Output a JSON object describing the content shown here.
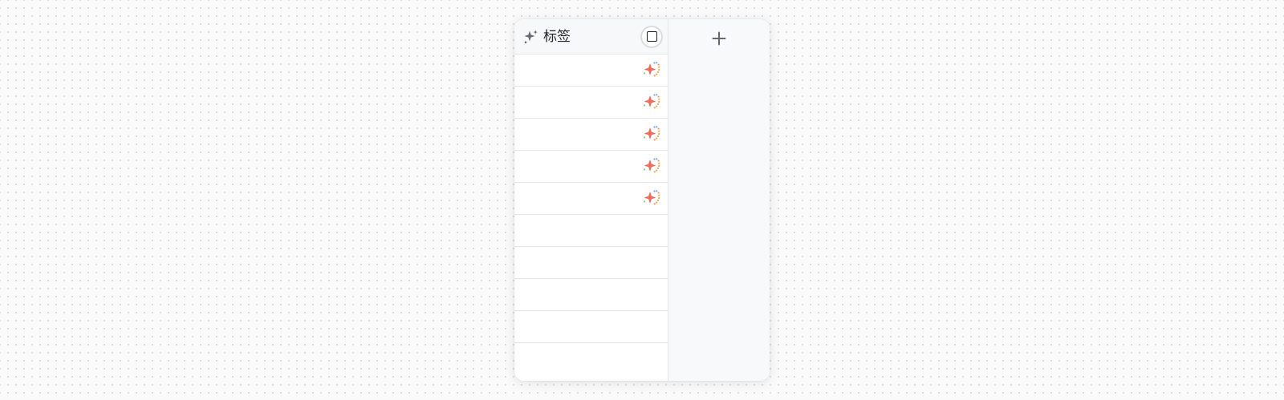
{
  "column": {
    "title": "标签",
    "title_icon": "sparkle-icon",
    "select_all_icon": "checkbox-square-icon"
  },
  "rows": [
    {
      "has_ai_fill": true
    },
    {
      "has_ai_fill": true
    },
    {
      "has_ai_fill": true
    },
    {
      "has_ai_fill": true
    },
    {
      "has_ai_fill": true
    },
    {
      "has_ai_fill": false
    },
    {
      "has_ai_fill": false
    },
    {
      "has_ai_fill": false
    },
    {
      "has_ai_fill": false
    },
    {
      "has_ai_fill": false
    }
  ],
  "add_column": {
    "icon": "plus-icon"
  },
  "colors": {
    "accent_star": "#f26b5b",
    "dots_blue": "#6ea8f5",
    "dots_orange": "#f5a04a",
    "dots_green": "#7ccf8a",
    "header_bg": "#f7f8fa",
    "icon_gray": "#646a73"
  }
}
